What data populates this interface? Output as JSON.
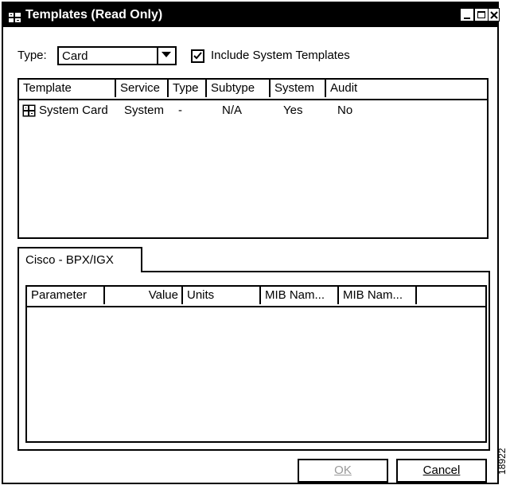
{
  "window": {
    "title": "Templates (Read Only)",
    "app_icon": "templates-app-icon",
    "controls": [
      "minimize-icon",
      "maximize-icon",
      "close-icon"
    ]
  },
  "filter": {
    "type_label": "Type:",
    "type_value": "Card",
    "include_system_label": "Include System Templates",
    "include_system_checked": true
  },
  "templates_table": {
    "columns": [
      "Template",
      "Service",
      "Type",
      "Subtype",
      "System",
      "Audit"
    ],
    "rows": [
      {
        "icon": "card-template-icon",
        "template": "System Card",
        "service": "System",
        "type": "-",
        "subtype": "N/A",
        "system": "Yes",
        "audit": "No"
      }
    ]
  },
  "tab": {
    "label": "Cisco - BPX/IGX"
  },
  "params_table": {
    "columns": [
      "Parameter",
      "Value",
      "Units",
      "MIB Nam...",
      "MIB Nam...",
      ""
    ]
  },
  "buttons": {
    "ok_label": "OK",
    "cancel_label": "Cancel",
    "ok_enabled": false
  },
  "figure_code": "18922"
}
